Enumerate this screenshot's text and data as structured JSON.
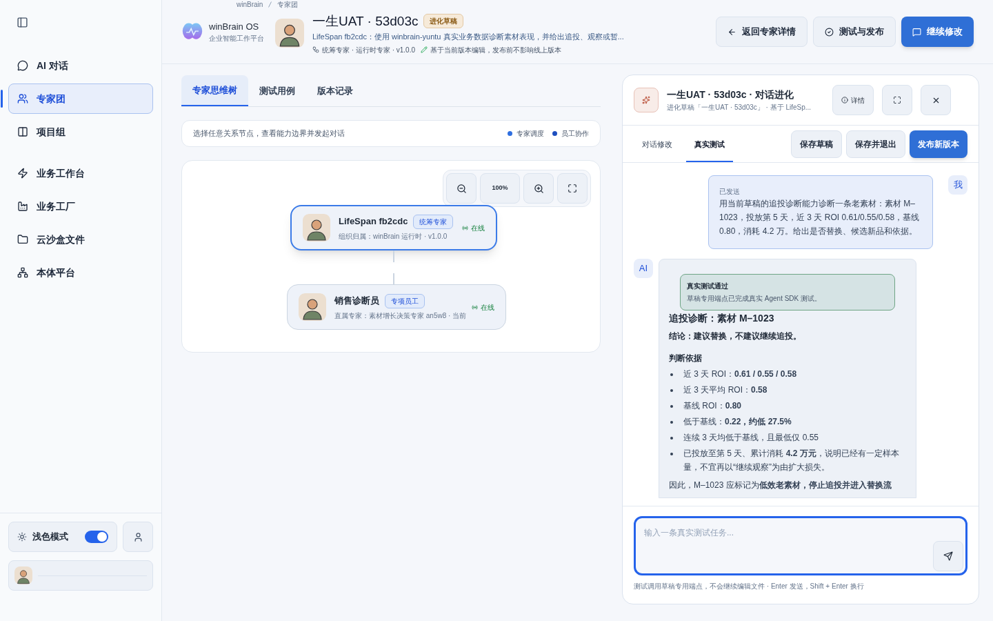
{
  "sidebar": {
    "items": [
      {
        "label": "AI 对话",
        "kind": "chat",
        "selected": false
      },
      {
        "label": "专家团",
        "kind": "team",
        "selected": true
      },
      {
        "label": "项目组",
        "kind": "project",
        "selected": false
      },
      {
        "label": "业务工作台",
        "kind": "bolt",
        "selected": false
      },
      {
        "label": "业务工厂",
        "kind": "factory",
        "selected": false
      },
      {
        "label": "云沙盒文件",
        "kind": "folder",
        "selected": false
      },
      {
        "label": "本体平台",
        "kind": "network",
        "selected": false
      }
    ],
    "theme_toggle": {
      "label": "浅色模式",
      "on": true
    }
  },
  "brand": {
    "name": "winBrain OS",
    "subtitle": "企业智能工作平台"
  },
  "breadcrumb": [
    "winBrain",
    "专家团"
  ],
  "expert": {
    "title": "一生UAT · 53d03c",
    "badge": "进化草稿",
    "description": "LifeSpan fb2cdc：使用 winbrain-yuntu 真实业务数据诊断素材表现，并给出追投、观察或暂...",
    "meta": "统筹专家 · 运行时专家 · v1.0.0",
    "edit_note": "基于当前版本编辑，发布前不影响线上版本"
  },
  "header_buttons": [
    {
      "label": "返回专家详情",
      "kind": "back",
      "primary": false
    },
    {
      "label": "测试与发布",
      "kind": "check",
      "primary": false
    },
    {
      "label": "继续修改",
      "kind": "chat",
      "primary": true
    }
  ],
  "tabs": [
    {
      "label": "专家思维树",
      "selected": true
    },
    {
      "label": "测试用例",
      "selected": false
    },
    {
      "label": "版本记录",
      "selected": false
    }
  ],
  "hint_bar": {
    "text": "选择任意关系节点，查看能力边界并发起对话",
    "legend": [
      {
        "label": "专家调度",
        "color": "#2f6fe0"
      },
      {
        "label": "员工协作",
        "color": "#1e4fbf"
      }
    ]
  },
  "canvas": {
    "zoom": "100%",
    "nodes": [
      {
        "name": "LifeSpan fb2cdc",
        "tag": "统筹专家",
        "meta": "组织归属：winBrain 运行时 · v1.0.0",
        "status": "在线",
        "selected": true
      },
      {
        "name": "销售诊断员",
        "tag": "专项员工",
        "meta": "直属专家：素材增长决策专家 an5w8 · 当前",
        "status": "在线",
        "selected": false
      }
    ]
  },
  "panel": {
    "title": "一生UAT · 53d03c · 对话进化",
    "subtitle": "进化草稿「一生UAT · 53d03c」 · 基于 LifeSp...",
    "detail_button": "详情",
    "tabs": [
      {
        "label": "对话修改",
        "selected": false
      },
      {
        "label": "真实测试",
        "selected": true
      }
    ],
    "actions": [
      {
        "label": "保存草稿",
        "primary": false
      },
      {
        "label": "保存并退出",
        "primary": false
      },
      {
        "label": "发布新版本",
        "primary": true
      }
    ],
    "messages": [
      {
        "kind": "user",
        "avatar": "我",
        "status": "已发送",
        "text": "用当前草稿的追投诊断能力诊断一条老素材：素材 M–1023，投放第 5 天，近 3 天 ROI 0.61/0.55/0.58，基线 0.80，消耗 4.2 万。给出是否替换、候选新品和依据。"
      },
      {
        "kind": "ai",
        "avatar": "AI",
        "notice": {
          "title": "真实测试通过",
          "text": "草稿专用端点已完成真实 Agent SDK 测试。"
        },
        "heading": "追投诊断：素材 M–1023",
        "conclusion": "结论：建议替换，不建议继续追投。",
        "section": "判断依据",
        "bullets": [
          "近 3 天 ROI：**0.61 / 0.55 / 0.58**",
          "近 3 天平均 ROI：**0.58**",
          "基线 ROI：**0.80**",
          "低于基线：**0.22，约低 27.5%**",
          "连续 3 天均低于基线，且最低仅 0.55",
          "已投放至第 5 天、累计消耗 **4.2 万元**，说明已经有一定样本量，不宜再以“继续观察”为由扩大损失。"
        ],
        "closing": "因此，M–1023 应标记为**低效老素材，停止追投并进入替换流**"
      }
    ],
    "input": {
      "placeholder": "输入一条真实测试任务..."
    },
    "footnote": "测试调用草稿专用端点，不会继续编辑文件 · Enter 发送，Shift + Enter 换行"
  }
}
